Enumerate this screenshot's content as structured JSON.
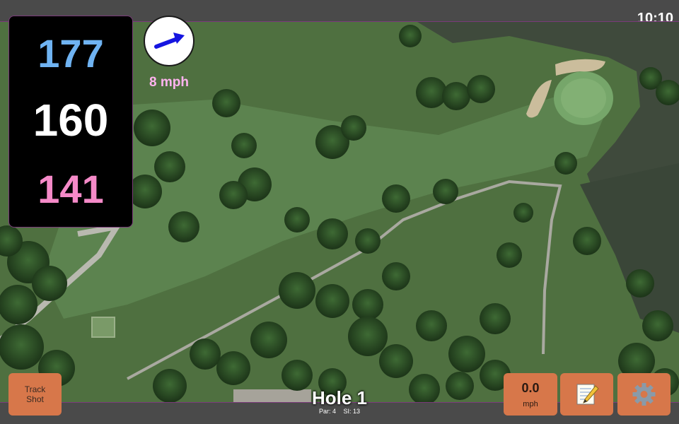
{
  "status": {
    "time": "10:10"
  },
  "distances": {
    "back": "177",
    "center": "160",
    "front": "141"
  },
  "wind": {
    "speed_label": "8 mph",
    "icon": "wind-arrow-icon"
  },
  "buttons": {
    "track_shot_line1": "Track",
    "track_shot_line2": "Shot",
    "speed_value": "0.0",
    "speed_unit": "mph",
    "notes_icon": "notes-icon",
    "settings_icon": "gear-icon"
  },
  "hole": {
    "title": "Hole 1",
    "par": "Par: 4",
    "si": "SI: 13"
  },
  "colors": {
    "back": "#6fb3f2",
    "center": "#ffffff",
    "front": "#f58ac8",
    "button": "#d7774a",
    "wind_text": "#ffb3ef",
    "water": "#3f4a3c"
  }
}
